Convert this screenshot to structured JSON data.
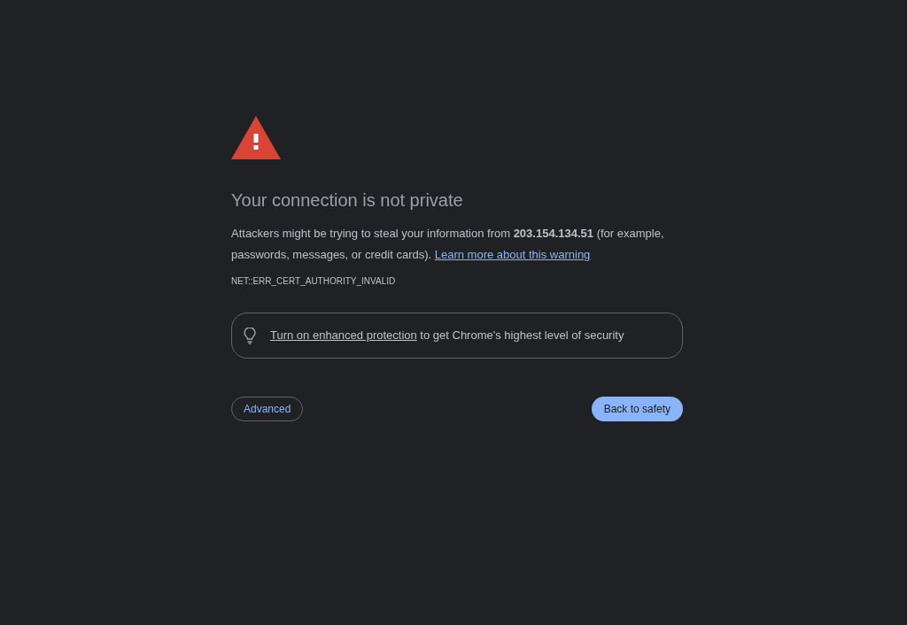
{
  "heading": "Your connection is not private",
  "message": {
    "text": "Attackers might be trying to steal your information from **203.154.134.51** (for example, passwords, messages, or credit cards).",
    "link": "Learn more about this warning"
  },
  "error_code": "NET::ERR_CERT_AUTHORITY_INVALID",
  "protection_banner": {
    "link": "Turn on enhanced protection",
    "text": "to get Chrome's highest level of security"
  },
  "buttons": [
    {
      "label": "Advanced",
      "kind": "secondary"
    },
    {
      "label": "Back to safety",
      "kind": "primary"
    }
  ]
}
